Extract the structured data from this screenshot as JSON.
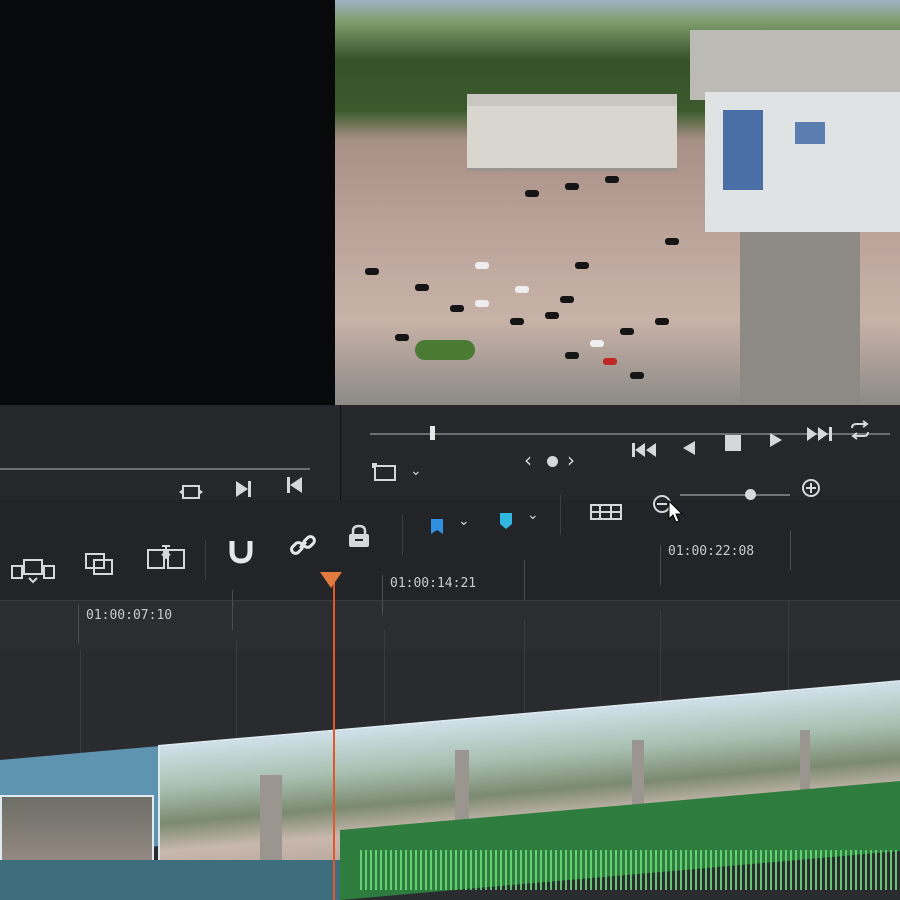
{
  "viewers": {
    "source": {
      "name": "source-viewer"
    },
    "program": {
      "name": "program-viewer"
    }
  },
  "transport": {
    "source_icons": [
      "loop-icon",
      "match-frame-icon",
      "next-frame-icon",
      "prev-edit-icon"
    ],
    "program_icons": [
      "jump-start-icon",
      "play-reverse-icon",
      "stop-icon",
      "play-icon",
      "jump-end-icon",
      "loop-icon"
    ],
    "nav_prev": "‹",
    "nav_next": "›",
    "playhead_fraction": 0.12
  },
  "toolbar": {
    "icons": [
      "overwrite-clip-icon",
      "replace-clip-icon",
      "ripple-overwrite-icon",
      "snapping-icon",
      "linked-selection-icon",
      "position-lock-icon",
      "flag-icon",
      "marker-icon",
      "timeline-view-options-icon",
      "zoom-out-icon",
      "zoom-in-icon"
    ],
    "flag_color": "#2f8fe0",
    "marker_color": "#2fb7e0",
    "zoom_level": 0.62
  },
  "timeline": {
    "timecodes": [
      "01:00:07:10",
      "01:00:14:21",
      "01:00:22:08"
    ],
    "playhead_color": "#e0582c"
  },
  "colors": {
    "accent": "#e27a3f",
    "audio": "#2f7d3e",
    "video_clip_border": "#dfeaf0"
  }
}
